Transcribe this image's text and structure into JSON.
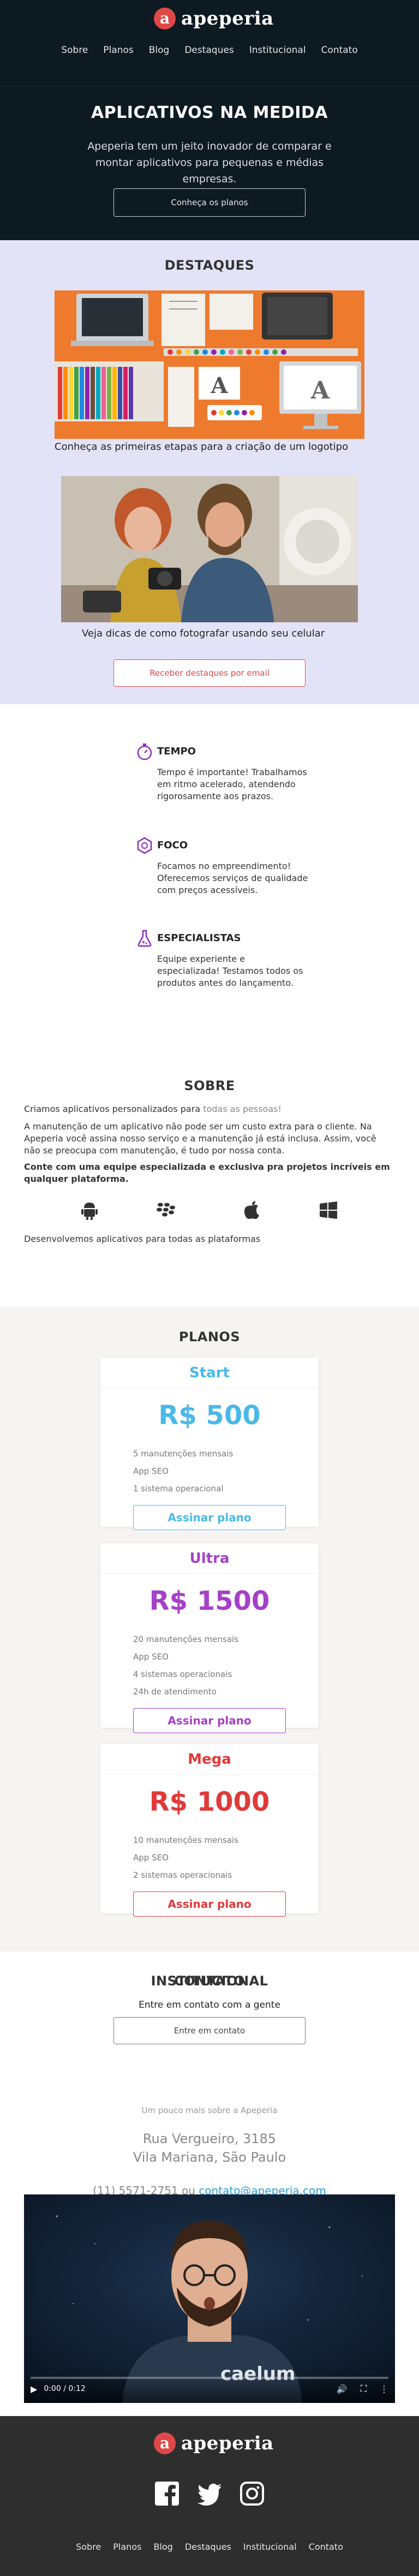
{
  "brand": {
    "name": "apeperia",
    "logo_letter": "a",
    "accent": "#e04848"
  },
  "nav": [
    "Sobre",
    "Planos",
    "Blog",
    "Destaques",
    "Institucional",
    "Contato"
  ],
  "hero": {
    "title": "APLICATIVOS NA MEDIDA",
    "text": "Apeperia tem um jeito inovador de comparar e montar aplicativos para pequenas e médias empresas.",
    "button": "Conheça os planos"
  },
  "destaques": {
    "title": "DESTAQUES",
    "items": [
      {
        "caption": "Conheça as primeiras etapas para a criação de um logotipo"
      },
      {
        "caption": "Veja dicas de como fotografar usando seu celular"
      }
    ],
    "button": "Receber destaques por email"
  },
  "features": [
    {
      "icon": "stopwatch-icon",
      "title": "TEMPO",
      "text": "Tempo é importante! Trabalhamos em ritmo acelerado, atendendo rigorosamente aos prazos."
    },
    {
      "icon": "hexagon-icon",
      "title": "FOCO",
      "text": "Focamos no empreendimento! Oferecemos serviços de qualidade com preços acessíveis."
    },
    {
      "icon": "flask-icon",
      "title": "ESPECIALISTAS",
      "text": "Equipe experiente e especializada! Testamos todos os produtos antes do lançamento."
    }
  ],
  "sobre": {
    "title": "SOBRE",
    "p1_start": "Criamos aplicativos personalizados para",
    "p1_light": " todas as pessoas!",
    "p2": "A manutenção de um aplicativo não pode ser um custo extra para o cliente. Na Apeperia você assina nosso serviço e a manutenção já está inclusa. Assim, você não se preocupa com manutenção, é tudo por nossa conta.",
    "p3": "Conte com uma equipe especializada e exclusiva pra projetos incríveis em qualquer plataforma.",
    "platform_icons": [
      "android-icon",
      "blackberry-icon",
      "apple-icon",
      "windows-icon"
    ],
    "p4": "Desenvolvemos aplicativos para todas as plataformas"
  },
  "planos": {
    "title": "PLANOS",
    "plans": [
      {
        "name": "Start",
        "price": "R$ 500",
        "color": "#4ab8e8",
        "features": [
          "5 manutenções mensais",
          "App SEO",
          "1 sistema operacional"
        ],
        "button": "Assinar plano"
      },
      {
        "name": "Ultra",
        "price": "R$ 1500",
        "color": "#a640c8",
        "features": [
          "20 manutenções mensais",
          "App SEO",
          "4 sistemas operacionais",
          "24h de atendimento"
        ],
        "button": "Assinar plano"
      },
      {
        "name": "Mega",
        "price": "R$ 1000",
        "color": "#e03a3a",
        "features": [
          "10 manutenções mensais",
          "App SEO",
          "2 sistemas operacionais"
        ],
        "button": "Assinar plano"
      }
    ]
  },
  "contato": {
    "title": "CONTATO",
    "subtitle": "Entre em contato com a gente",
    "button": "Entre em contato"
  },
  "institucional": {
    "title": "INSTITUCIONAL",
    "subtitle": "Um pouco mais sobre a Apeperia",
    "address_line1": "Rua Vergueiro, 3185",
    "address_line2": "Vila Mariana, São Paulo",
    "phone": "(11) 5571-2751",
    "phone_sep": " ou ",
    "email": "contato@apeperia.com"
  },
  "video": {
    "time": "0:00 / 0:12",
    "shirt_text": "caelum"
  },
  "footer": {
    "social": [
      "facebook-icon",
      "twitter-icon",
      "instagram-icon"
    ],
    "nav": [
      "Sobre",
      "Planos",
      "Blog",
      "Destaques",
      "Institucional",
      "Contato"
    ]
  }
}
